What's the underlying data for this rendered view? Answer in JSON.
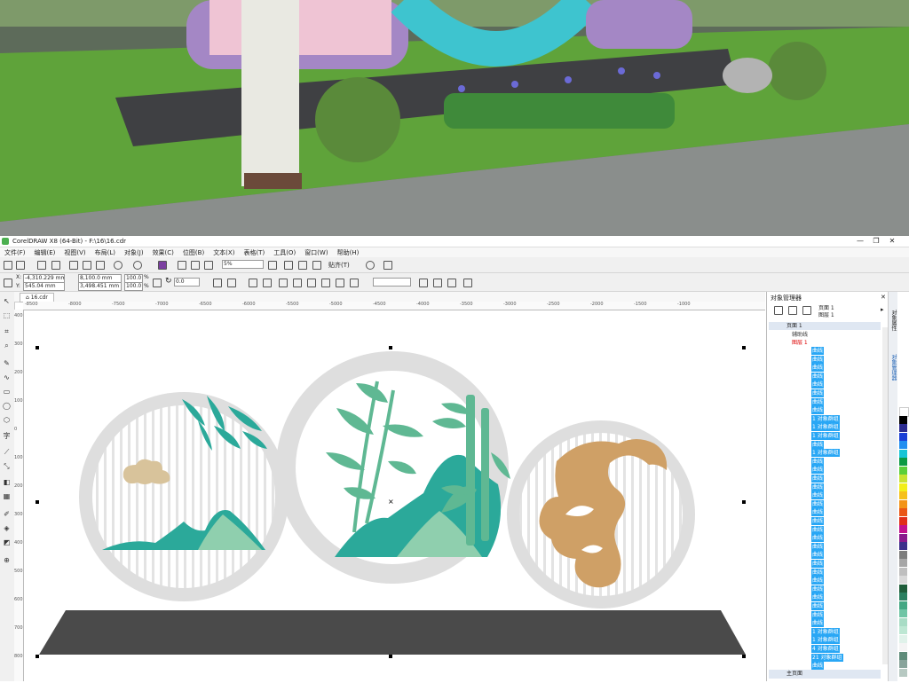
{
  "window": {
    "title": "CorelDRAW X8 (64-Bit) - F:\\16\\16.cdr",
    "minimize": "—",
    "restore": "❐",
    "close": "✕"
  },
  "menu": [
    "文件(F)",
    "编辑(E)",
    "视图(V)",
    "布局(L)",
    "对象(J)",
    "效果(C)",
    "位图(B)",
    "文本(X)",
    "表格(T)",
    "工具(O)",
    "窗口(W)",
    "帮助(H)"
  ],
  "toolbar": {
    "zoom": "5%",
    "snap": "贴齐(T)"
  },
  "property_bar": {
    "x": "-4,310.229 mm",
    "y": "545.04 mm",
    "w": "8,100.0 mm",
    "h": "3,498.451 mm",
    "sx": "100.0",
    "sy": "100.0",
    "pct1": "%",
    "pct2": "%",
    "rotation": "0.0"
  },
  "document_tab": "16.cdr",
  "ruler": {
    "h_labels": [
      "-8500",
      "-8000",
      "-7500",
      "-7000",
      "-6500",
      "-6000",
      "-5500",
      "-5000",
      "-4500",
      "-4000",
      "-3500",
      "-3000",
      "-2500",
      "-2000",
      "-1500",
      "-1000"
    ],
    "v_labels": [
      "400",
      "300",
      "200",
      "100",
      "0",
      "100",
      "200",
      "300",
      "400",
      "500",
      "600",
      "700",
      "800"
    ]
  },
  "object_manager": {
    "title": "对象管理器",
    "page_label": "页面 1",
    "layer_label": "图层 1",
    "page_node": "页面 1",
    "guides_layer": "辅助线",
    "layer1": "图层 1",
    "items": [
      "曲线",
      "曲线",
      "曲线",
      "曲线",
      "曲线",
      "曲线",
      "曲线",
      "曲线",
      "1 对象群组",
      "1 对象群组",
      "1 对象群组",
      "曲线",
      "1 对象群组",
      "曲线",
      "曲线",
      "曲线",
      "曲线",
      "曲线",
      "曲线",
      "曲线",
      "曲线",
      "曲线",
      "曲线",
      "曲线",
      "曲线",
      "曲线",
      "曲线",
      "曲线",
      "曲线",
      "曲线",
      "曲线",
      "曲线",
      "曲线",
      "1 对象群组",
      "1 对象群组",
      "4 对象群组",
      "21 对象群组",
      "曲线"
    ],
    "master_page": "主页面",
    "vtabs": [
      "对象属性",
      "对象管理器"
    ]
  },
  "colors": {
    "accent_teal": "#2ba99a",
    "mint": "#8fcfae",
    "leaf": "#5fb893",
    "gold": "#cfa066",
    "ring": "#dedede",
    "base": "#4a4a4a",
    "select": "#29a7f5",
    "cloud": "#d8c39b"
  },
  "palette": [
    "#ffffff",
    "#000000",
    "#2b2b8f",
    "#1a3fd6",
    "#1f8ef0",
    "#17c5d6",
    "#0b9a43",
    "#5bcf3a",
    "#c7e232",
    "#f2ee19",
    "#f6c019",
    "#f39418",
    "#ea5616",
    "#e12e19",
    "#c2128d",
    "#8a1a8c",
    "#3d2f8a",
    "#7d7d7d",
    "#a6a6a6",
    "#bfbfbf",
    "#d9d9d9",
    "#1f5d3a",
    "#2a8060",
    "#43a783",
    "#6fc5a5",
    "#a8dcc5",
    "#bde7d3",
    "#e0f2ea",
    "#f4f4f4",
    "#5f8c7a",
    "#87a39a",
    "#b7c9c2"
  ]
}
